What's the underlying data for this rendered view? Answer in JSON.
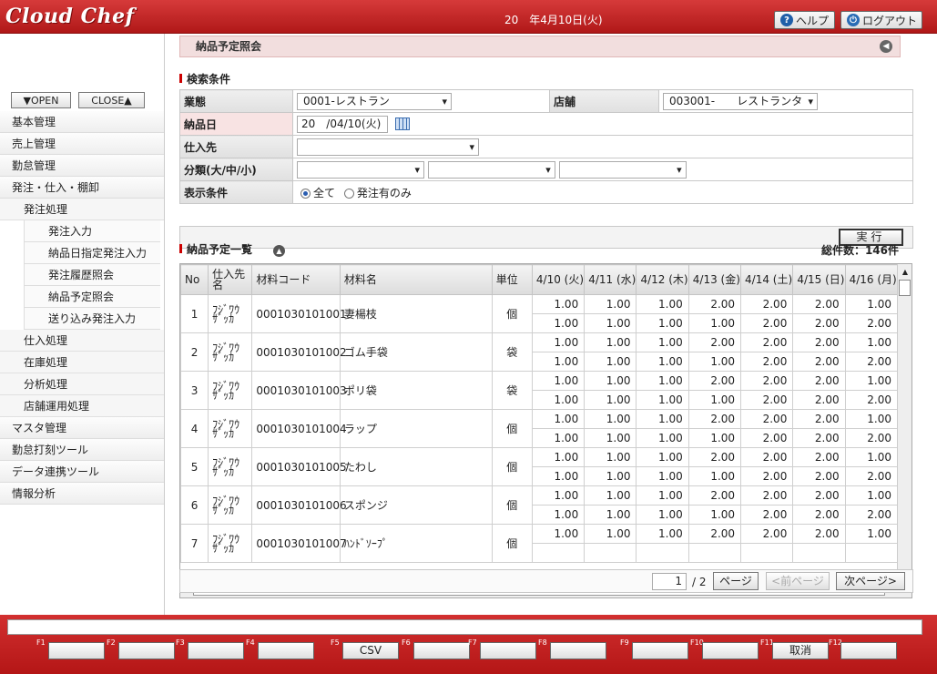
{
  "header": {
    "logo": "Cloud Chef",
    "date": "20　年4月10日(火)",
    "help_label": "ヘルプ",
    "logout_label": "ログアウト"
  },
  "sidebar": {
    "open_label": "▼OPEN",
    "close_label": "CLOSE▲",
    "items": [
      {
        "label": "基本管理",
        "level": 0
      },
      {
        "label": "売上管理",
        "level": 0
      },
      {
        "label": "勤怠管理",
        "level": 0
      },
      {
        "label": "発注・仕入・棚卸",
        "level": 0
      },
      {
        "label": "発注処理",
        "level": 1
      },
      {
        "label": "発注入力",
        "level": 2
      },
      {
        "label": "納品日指定発注入力",
        "level": 2
      },
      {
        "label": "発注履歴照会",
        "level": 2
      },
      {
        "label": "納品予定照会",
        "level": 2
      },
      {
        "label": "送り込み発注入力",
        "level": 2
      },
      {
        "label": "仕入処理",
        "level": 1
      },
      {
        "label": "在庫処理",
        "level": 1
      },
      {
        "label": "分析処理",
        "level": 1
      },
      {
        "label": "店舗運用処理",
        "level": 1
      },
      {
        "label": "マスタ管理",
        "level": 0
      },
      {
        "label": "勤怠打刻ツール",
        "level": 0
      },
      {
        "label": "データ連携ツール",
        "level": 0
      },
      {
        "label": "情報分析",
        "level": 0
      }
    ]
  },
  "page": {
    "title": "納品予定照会",
    "search_heading": "検索条件",
    "list_heading": "納品予定一覧",
    "total": "総件数：146件"
  },
  "search": {
    "business_label": "業態",
    "business_value": "0001-レストラン",
    "store_label": "店舗",
    "store_value": "003001-　　レストランタ",
    "delivery_label": "納品日",
    "delivery_value": "20　/04/10(火)",
    "supplier_label": "仕入先",
    "supplier_value": "",
    "category_label": "分類(大/中/小)",
    "display_label": "表示条件",
    "opt_all": "全て",
    "opt_ordered": "発注有のみ",
    "exec_label": "実行"
  },
  "grid": {
    "headers": {
      "no": "No",
      "supplier": "仕入先名",
      "code": "材料コード",
      "name": "材料名",
      "unit": "単位",
      "d1": "4/10 (火)",
      "d2": "4/11 (水)",
      "d3": "4/12 (木)",
      "d4": "4/13 (金)",
      "d5": "4/14 (土)",
      "d6": "4/15 (日)",
      "d7": "4/16 (月)"
    },
    "rows": [
      {
        "no": "1",
        "supplier": "ﾌｼﾞﾜｳ ｻﾞｯｶ",
        "code": "0001030101001",
        "name": "妻楊枝",
        "unit": "個",
        "a": [
          "1.00",
          "1.00",
          "1.00",
          "2.00",
          "2.00",
          "2.00",
          "1.00"
        ],
        "b": [
          "1.00",
          "1.00",
          "1.00",
          "1.00",
          "2.00",
          "2.00",
          "2.00"
        ]
      },
      {
        "no": "2",
        "supplier": "ﾌｼﾞﾜｳ ｻﾞｯｶ",
        "code": "0001030101002",
        "name": "ゴム手袋",
        "unit": "袋",
        "a": [
          "1.00",
          "1.00",
          "1.00",
          "2.00",
          "2.00",
          "2.00",
          "1.00"
        ],
        "b": [
          "1.00",
          "1.00",
          "1.00",
          "1.00",
          "2.00",
          "2.00",
          "2.00"
        ]
      },
      {
        "no": "3",
        "supplier": "ﾌｼﾞﾜｳ ｻﾞｯｶ",
        "code": "0001030101003",
        "name": "ポリ袋",
        "unit": "袋",
        "a": [
          "1.00",
          "1.00",
          "1.00",
          "2.00",
          "2.00",
          "2.00",
          "1.00"
        ],
        "b": [
          "1.00",
          "1.00",
          "1.00",
          "1.00",
          "2.00",
          "2.00",
          "2.00"
        ]
      },
      {
        "no": "4",
        "supplier": "ﾌｼﾞﾜｳ ｻﾞｯｶ",
        "code": "0001030101004",
        "name": "ラップ",
        "unit": "個",
        "a": [
          "1.00",
          "1.00",
          "1.00",
          "2.00",
          "2.00",
          "2.00",
          "1.00"
        ],
        "b": [
          "1.00",
          "1.00",
          "1.00",
          "1.00",
          "2.00",
          "2.00",
          "2.00"
        ]
      },
      {
        "no": "5",
        "supplier": "ﾌｼﾞﾜｳ ｻﾞｯｶ",
        "code": "0001030101005",
        "name": "たわし",
        "unit": "個",
        "a": [
          "1.00",
          "1.00",
          "1.00",
          "2.00",
          "2.00",
          "2.00",
          "1.00"
        ],
        "b": [
          "1.00",
          "1.00",
          "1.00",
          "1.00",
          "2.00",
          "2.00",
          "2.00"
        ]
      },
      {
        "no": "6",
        "supplier": "ﾌｼﾞﾜｳ ｻﾞｯｶ",
        "code": "0001030101006",
        "name": "スポンジ",
        "unit": "個",
        "a": [
          "1.00",
          "1.00",
          "1.00",
          "2.00",
          "2.00",
          "2.00",
          "1.00"
        ],
        "b": [
          "1.00",
          "1.00",
          "1.00",
          "1.00",
          "2.00",
          "2.00",
          "2.00"
        ]
      },
      {
        "no": "7",
        "supplier": "ﾌｼﾞﾜｳ ｻﾞｯｶ",
        "code": "0001030101007",
        "name": "ﾊﾝﾄﾞｿｰﾌﾟ",
        "unit": "個",
        "a": [
          "1.00",
          "1.00",
          "1.00",
          "2.00",
          "2.00",
          "2.00",
          "1.00"
        ],
        "b": [
          "",
          "",
          "",
          "",
          "",
          "",
          ""
        ]
      }
    ]
  },
  "pager": {
    "current": "1",
    "total": "/ 2",
    "go_label": "ページ",
    "prev_label": "<前ページ",
    "next_label": "次ページ>"
  },
  "footer": {
    "keys": [
      {
        "key": "F1",
        "label": ""
      },
      {
        "key": "F2",
        "label": ""
      },
      {
        "key": "F3",
        "label": ""
      },
      {
        "key": "F4",
        "label": ""
      },
      {
        "key": "F5",
        "label": "CSV"
      },
      {
        "key": "F6",
        "label": ""
      },
      {
        "key": "F7",
        "label": ""
      },
      {
        "key": "F8",
        "label": ""
      },
      {
        "key": "F9",
        "label": ""
      },
      {
        "key": "F10",
        "label": ""
      },
      {
        "key": "F11",
        "label": "取消"
      },
      {
        "key": "F12",
        "label": ""
      }
    ]
  },
  "colors": {
    "brand_red": "#c02020",
    "title_bg": "#f2dede",
    "accent_mark": "#cc0000"
  }
}
